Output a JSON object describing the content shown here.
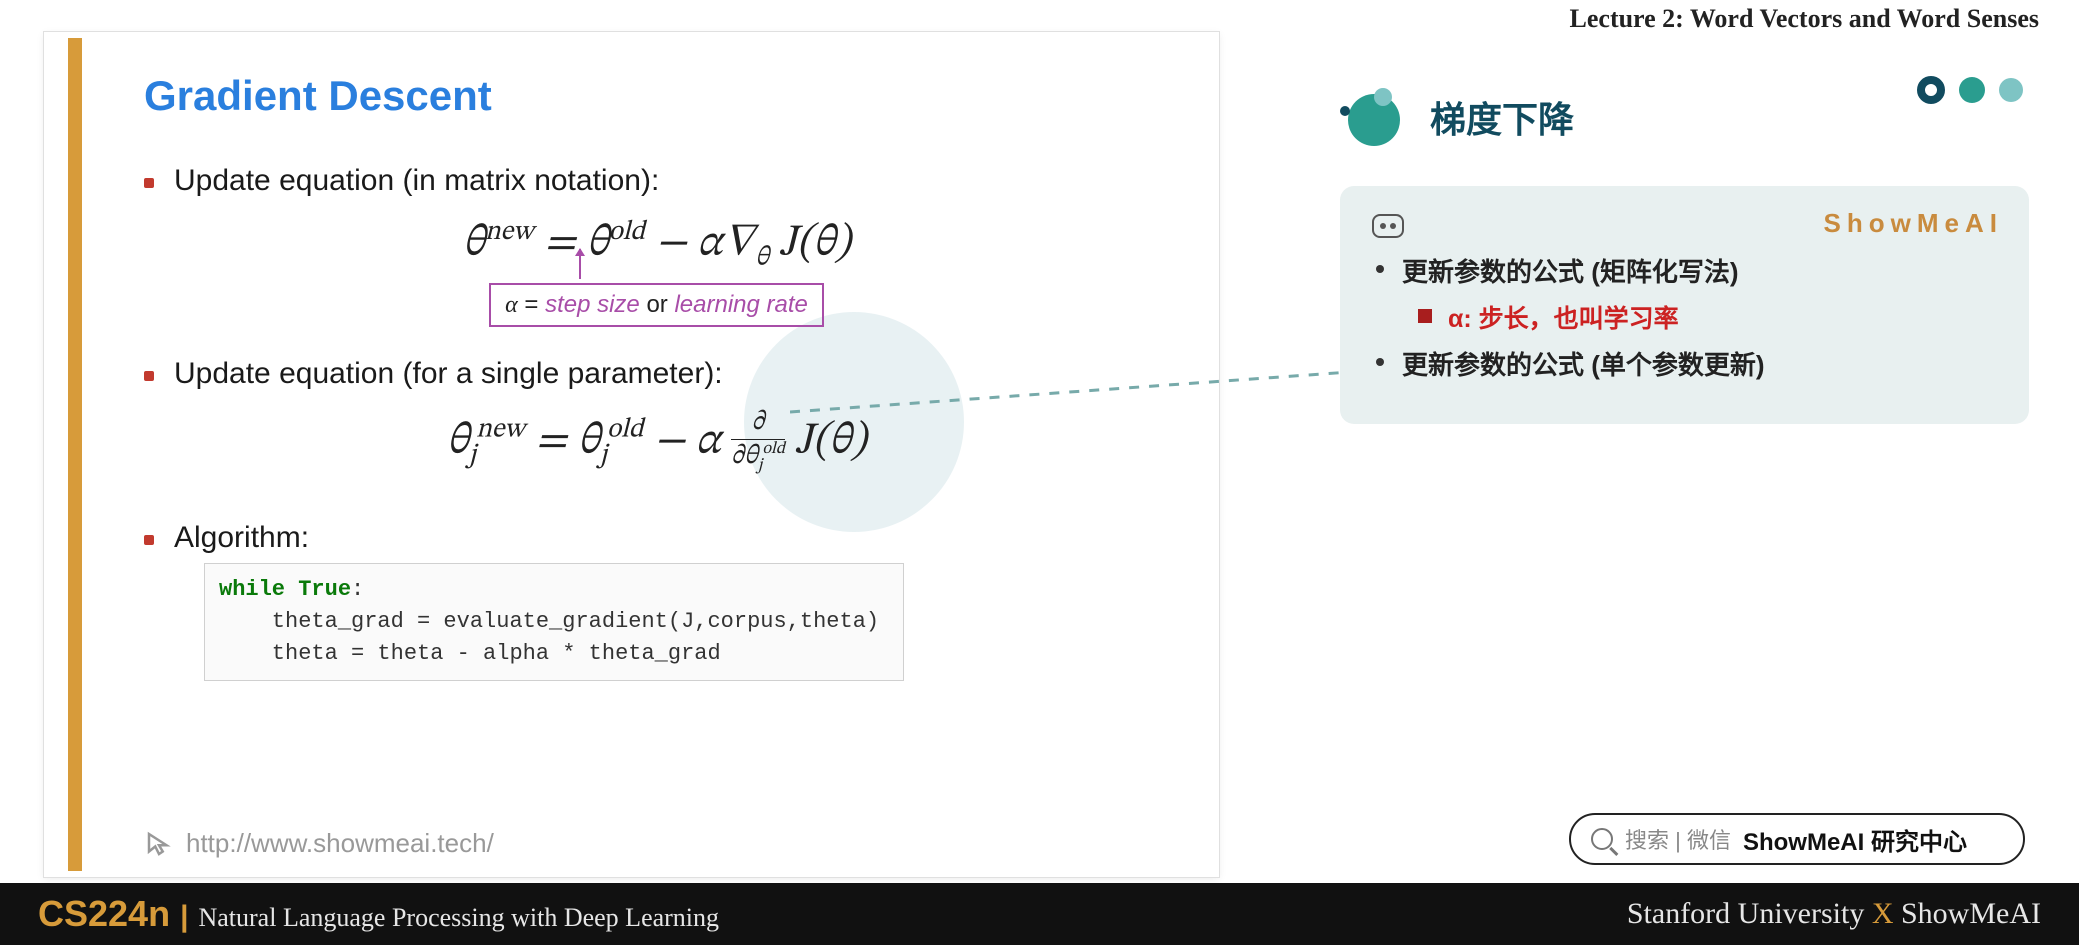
{
  "lecture_label": "Lecture 2:   Word Vectors and Word Senses",
  "slide": {
    "title": "Gradient Descent",
    "bullet1": "Update equation (in matrix notation):",
    "equation1_html": "θ<sup>new</sup> = θ<sup>old</sup> − α∇<sub>θ</sub> J(θ)",
    "note_alpha": "α",
    "note_eq": " = ",
    "note_step": "step size",
    "note_or": " or ",
    "note_lr": "learning rate",
    "bullet2": "Update equation (for a single parameter):",
    "equation2_html": "θ<sub>j</sub><sup>new</sup> = θ<sub>j</sub><sup>old</sup> − α <span style=\"display:inline-block;vertical-align:middle;font-size:0.62em;line-height:1;\"><span style=\"display:block;border-bottom:1.5px solid #222;padding:0 4px 2px;\">∂</span><span style=\"display:block;padding-top:2px;\">∂θ<sub>j</sub><sup>old</sup></span></span> J(θ)",
    "bullet3": "Algorithm:",
    "code_line1_kw1": "while",
    "code_line1_kw2": "True",
    "code_line1_colon": ":",
    "code_line2": "    theta_grad = evaluate_gradient(J,corpus,theta)",
    "code_line3": "    theta = theta - alpha * theta_grad",
    "url": "http://www.showmeai.tech/"
  },
  "right": {
    "title": "梯度下降",
    "brand": "ShowMeAI",
    "b1": "更新参数的公式 (矩阵化写法)",
    "sub1": "α: 步长，也叫学习率",
    "b2": "更新参数的公式 (单个参数更新)"
  },
  "search": {
    "hint": "搜索 | 微信",
    "strong": "ShowMeAI 研究中心"
  },
  "footer": {
    "course": "CS224n",
    "pipe": "|",
    "subtitle": "Natural Language Processing with Deep Learning",
    "right_pre": "Stanford University ",
    "right_x": "X",
    "right_post": " ShowMeAI"
  }
}
